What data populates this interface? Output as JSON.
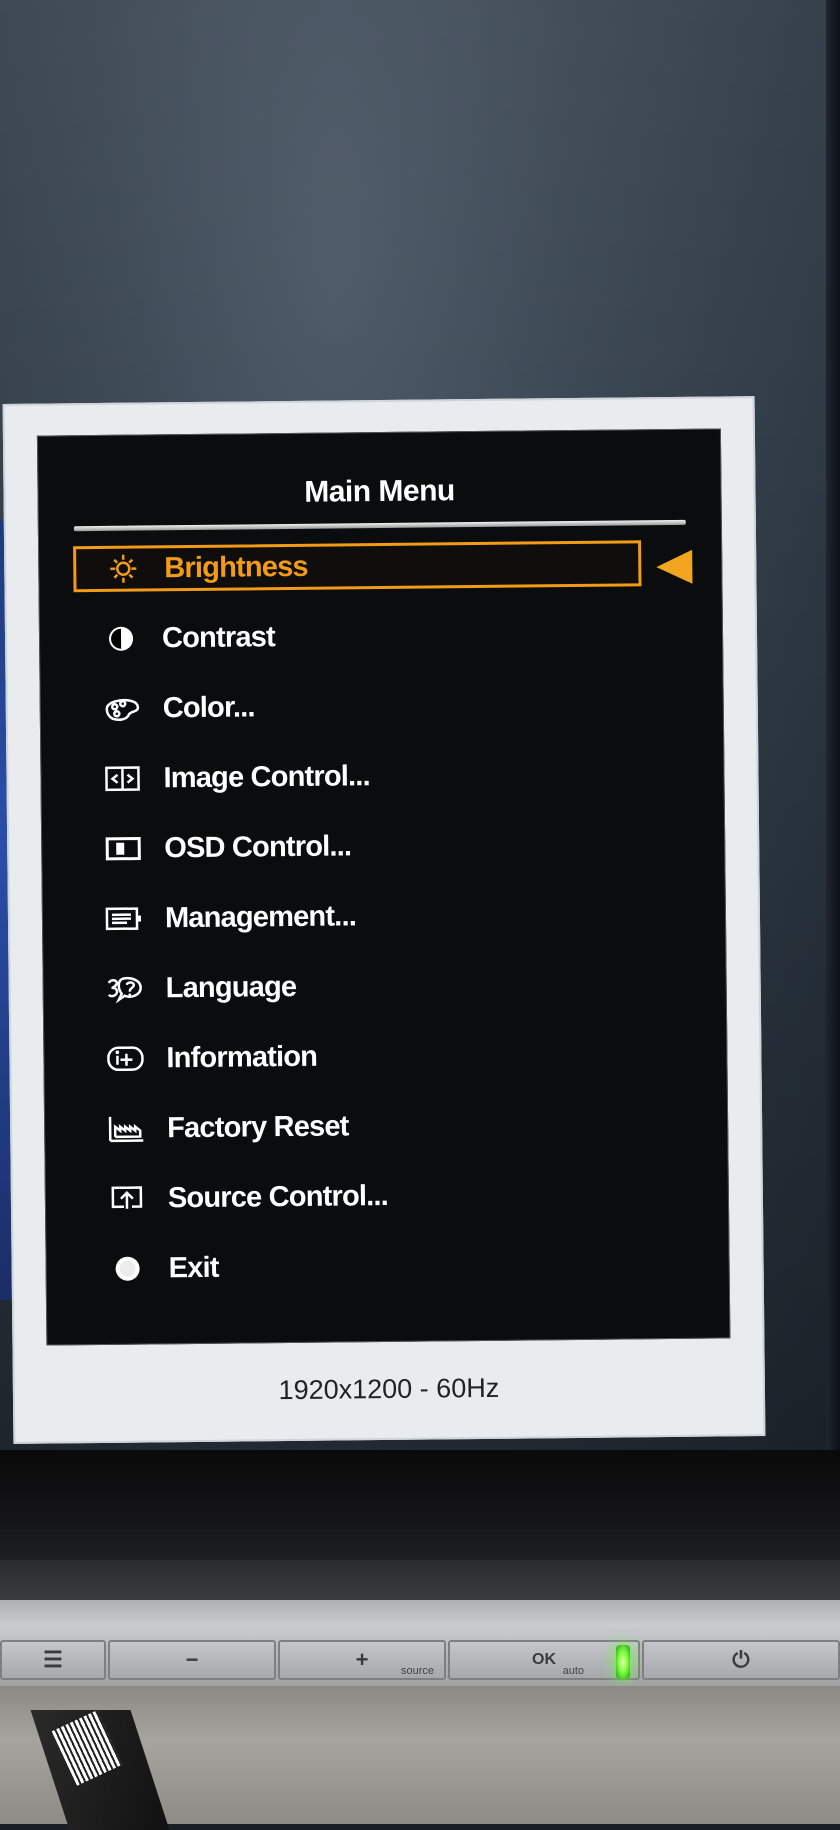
{
  "osd": {
    "title": "Main Menu",
    "status": "1920x1200 - 60Hz",
    "selected_color": "#f29b16",
    "items": [
      {
        "label": "Brightness",
        "icon": "sun-icon",
        "selected": true
      },
      {
        "label": "Contrast",
        "icon": "half-circle-icon",
        "selected": false
      },
      {
        "label": "Color...",
        "icon": "palette-icon",
        "selected": false
      },
      {
        "label": "Image Control...",
        "icon": "image-control-icon",
        "selected": false
      },
      {
        "label": "OSD Control...",
        "icon": "osd-control-icon",
        "selected": false
      },
      {
        "label": "Management...",
        "icon": "management-icon",
        "selected": false
      },
      {
        "label": "Language",
        "icon": "language-icon",
        "selected": false
      },
      {
        "label": "Information",
        "icon": "information-icon",
        "selected": false
      },
      {
        "label": "Factory Reset",
        "icon": "factory-icon",
        "selected": false
      },
      {
        "label": "Source Control...",
        "icon": "source-icon",
        "selected": false
      },
      {
        "label": "Exit",
        "icon": "exit-icon",
        "selected": false
      }
    ]
  },
  "hardware_buttons": {
    "minus": "−",
    "plus": "+",
    "plus_sub": "source",
    "ok": "OK",
    "ok_sub": "auto",
    "power": "⏻"
  }
}
